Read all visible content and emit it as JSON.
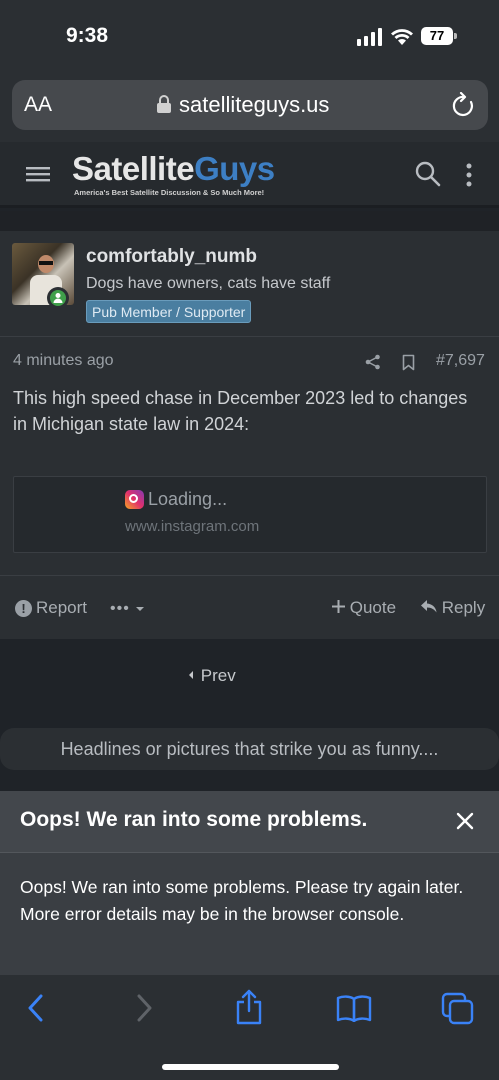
{
  "status_bar": {
    "time": "9:38",
    "battery": "77"
  },
  "browser": {
    "text_size_label": "AA",
    "url": "satelliteguys.us"
  },
  "site": {
    "logo_word_1": "Satellite",
    "logo_word_2": "Guys",
    "logo_tagline": "America's Best Satellite Discussion & So Much More!"
  },
  "post": {
    "username": "comfortably_numb",
    "user_title": "Dogs have owners, cats have staff",
    "user_banner": "Pub Member / Supporter",
    "time": "4 minutes ago",
    "number": "#7,697",
    "body": "This high speed chase in December 2023 led to changes in Michigan state law in 2024:",
    "embed_loading": "Loading...",
    "embed_domain": "www.instagram.com",
    "actions": {
      "report": "Report",
      "more": "•••",
      "quote": "Quote",
      "reply": "Reply"
    }
  },
  "nav": {
    "prev": "Prev",
    "thread_title": "Headlines or pictures that strike you as funny...."
  },
  "error": {
    "title": "Oops! We ran into some problems.",
    "message": "Oops! We ran into some problems. Please try again later. More error details may be in the browser console."
  },
  "colors": {
    "background": "#1f2328",
    "panel": "#2b2f33",
    "accent_blue": "#3a82f7",
    "banner": "#4a7ea0",
    "online": "#3fa04a"
  }
}
